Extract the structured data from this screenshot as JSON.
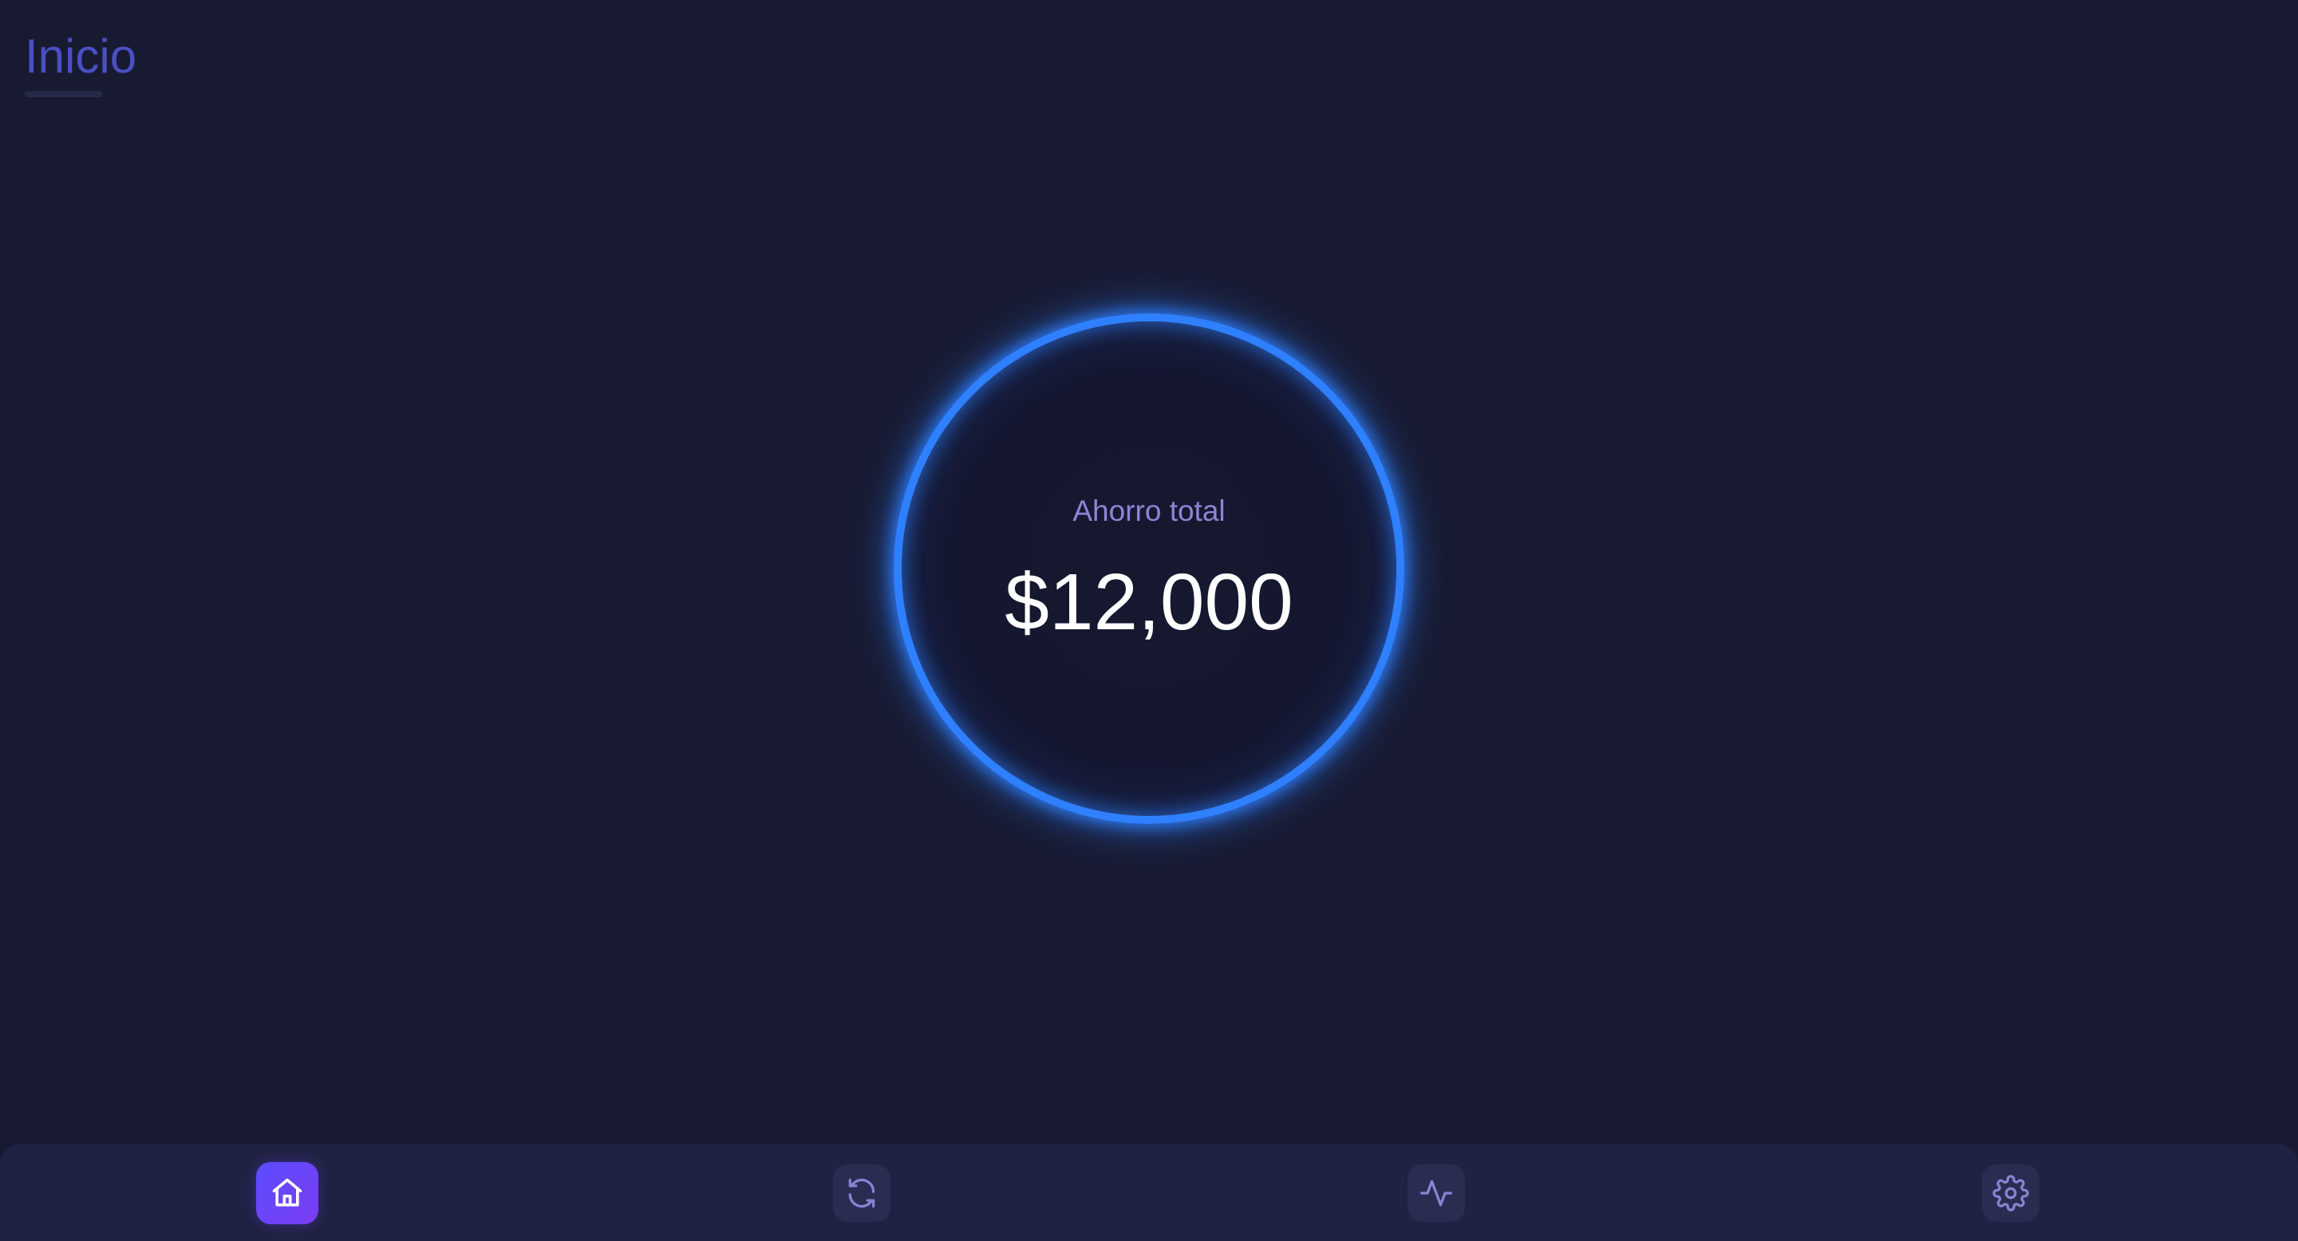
{
  "header": {
    "title": "Inicio"
  },
  "savings": {
    "label": "Ahorro total",
    "value": "$12,000"
  },
  "nav": {
    "items": [
      {
        "icon": "home-icon",
        "active": true
      },
      {
        "icon": "refresh-icon",
        "active": false
      },
      {
        "icon": "activity-icon",
        "active": false
      },
      {
        "icon": "gear-icon",
        "active": false
      }
    ]
  },
  "colors": {
    "background": "#181a31",
    "title": "#4a4fc4",
    "ring": "#2f80ff",
    "label": "#8e85d6",
    "value": "#ffffff",
    "nav_bar": "#202243",
    "nav_active_start": "#5b4dff",
    "nav_active_end": "#7b3cf2",
    "nav_icon_inactive": "#8a82d2"
  }
}
